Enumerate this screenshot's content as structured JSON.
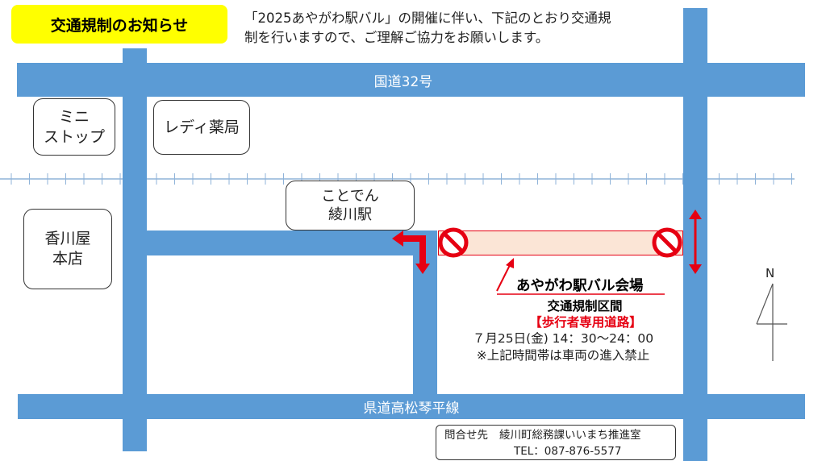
{
  "title": "交通規制のお知らせ",
  "notice": {
    "line1": "「2025あやがわ駅バル」の開催に伴い、下記のとおり交通規",
    "line2": "制を行いますので、ご理解ご協力をお願いします。"
  },
  "roads": {
    "national": "国道32号",
    "prefectural": "県道高松琴平線"
  },
  "landmarks": {
    "mini_stop": [
      "ミニ",
      "ストップ"
    ],
    "lady_drug": "レディ薬局",
    "kagawaya": [
      "香川屋",
      "本店"
    ],
    "station": [
      "ことでん",
      "綾川駅"
    ]
  },
  "event": {
    "venue": "あやがわ駅バル会場",
    "section": "交通規制区間",
    "pedestrian": "【歩行者専用道路】",
    "time": "７月25日(金) 14：30〜24：00",
    "note": "※上記時間帯は車両の進入禁止"
  },
  "compass": "N",
  "contact": {
    "label": "問合せ先",
    "office": "綾川町総務課いいまち推進室",
    "tel": "TEL：087-876-5577"
  },
  "colors": {
    "road": "#5b9bd5",
    "restricted_fill": "#fbe5d6",
    "restriction_red": "#e60012",
    "title_badge": "#ffff00"
  },
  "icons": [
    "no-entry-icon",
    "detour-arrow-icon",
    "double-arrow-icon",
    "pointer-arrow-icon",
    "north-arrow-icon",
    "railway-track"
  ]
}
